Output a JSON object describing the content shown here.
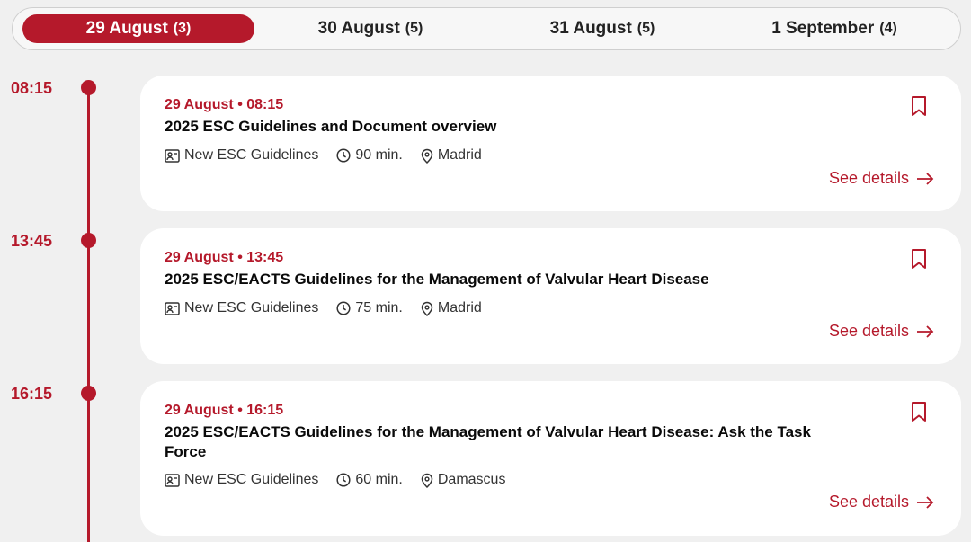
{
  "tabs": [
    {
      "label": "29 August",
      "count": "(3)",
      "active": true
    },
    {
      "label": "30 August",
      "count": "(5)",
      "active": false
    },
    {
      "label": "31 August",
      "count": "(5)",
      "active": false
    },
    {
      "label": "1 September",
      "count": "(4)",
      "active": false
    }
  ],
  "sessions": [
    {
      "time": "08:15",
      "date_time": "29 August • 08:15",
      "title": "2025 ESC Guidelines and Document overview",
      "category": "New ESC Guidelines",
      "duration": "90 min.",
      "location": "Madrid",
      "details_label": "See details"
    },
    {
      "time": "13:45",
      "date_time": "29 August • 13:45",
      "title": "2025 ESC/EACTS Guidelines for the Management of Valvular Heart Disease",
      "category": "New ESC Guidelines",
      "duration": "75 min.",
      "location": "Madrid",
      "details_label": "See details"
    },
    {
      "time": "16:15",
      "date_time": "29 August • 16:15",
      "title": "2025 ESC/EACTS Guidelines for the Management of Valvular Heart Disease: Ask the Task Force",
      "category": "New ESC Guidelines",
      "duration": "60 min.",
      "location": "Damascus",
      "details_label": "See details"
    }
  ],
  "icons": {
    "bookmark": "bookmark-icon",
    "category": "presenter-icon",
    "duration": "clock-icon",
    "location": "location-pin-icon",
    "arrow": "arrow-right-icon"
  },
  "colors": {
    "accent": "#b5192b",
    "background": "#f0f0f0",
    "card": "#ffffff"
  }
}
